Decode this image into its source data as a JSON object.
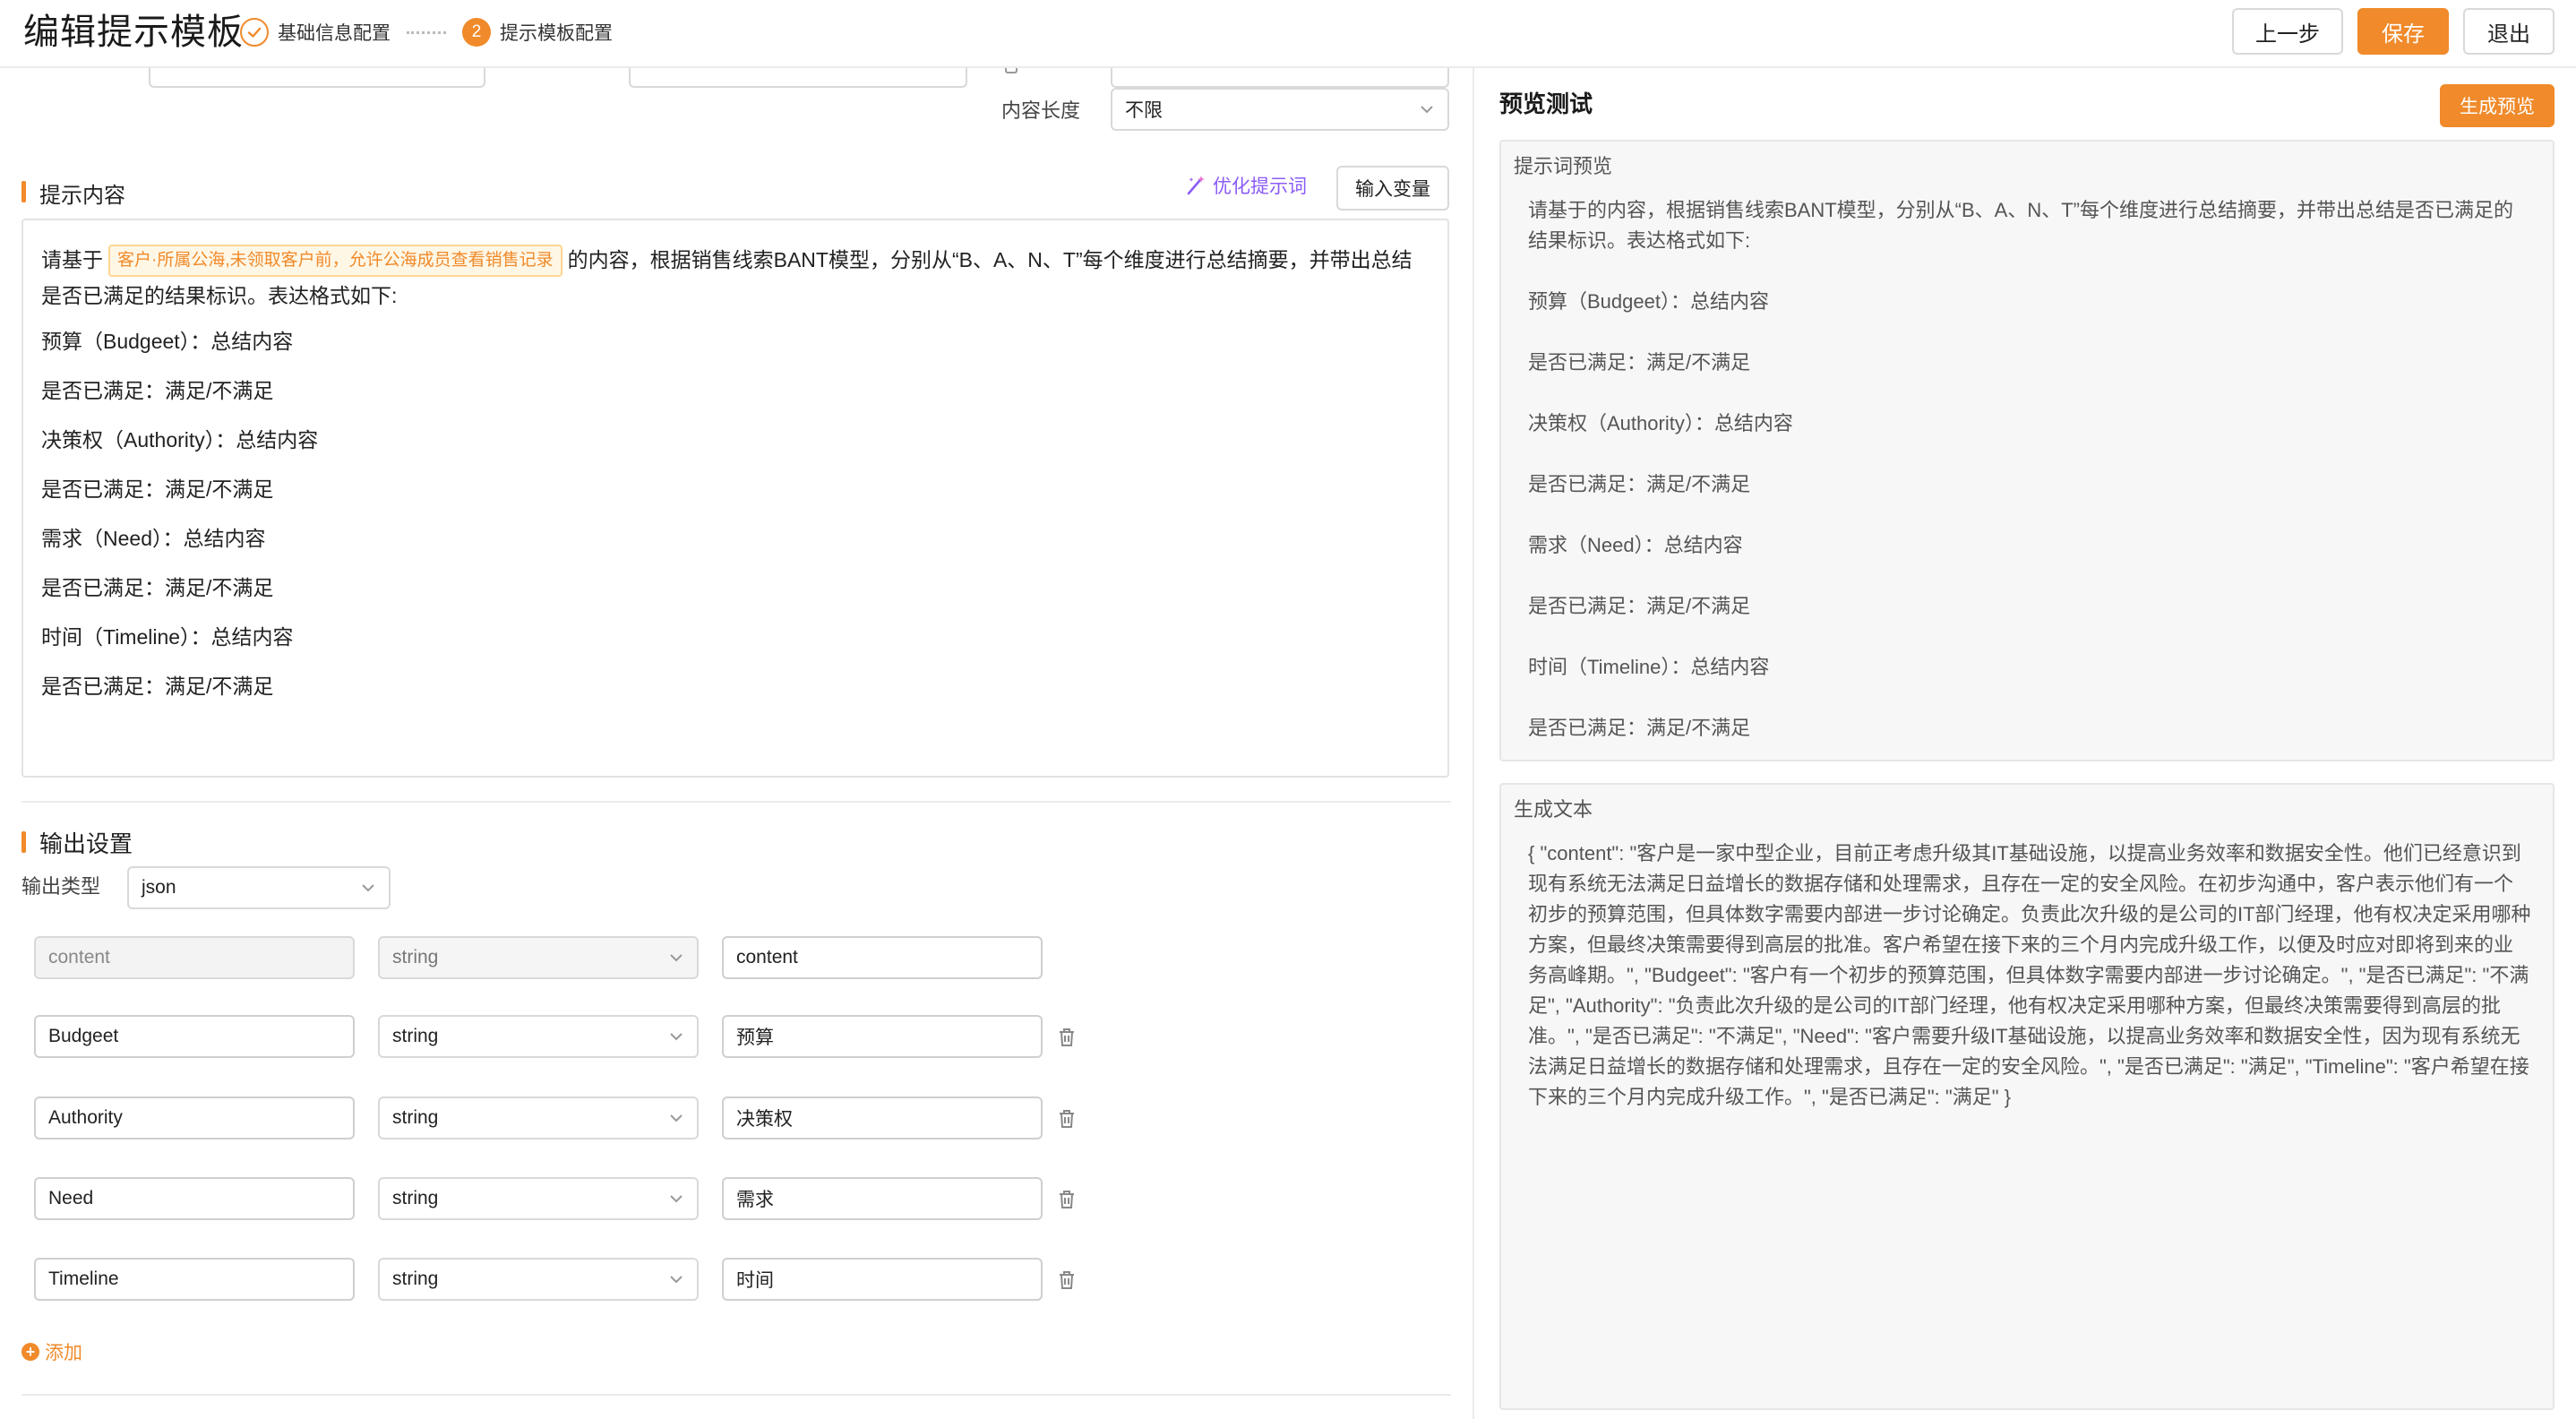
{
  "header": {
    "title": "编辑提示模板",
    "steps": [
      {
        "label": "基础信息配置"
      },
      {
        "number": "2",
        "label": "提示模板配置"
      }
    ],
    "buttons": {
      "prev": "上一步",
      "save": "保存",
      "exit": "退出"
    }
  },
  "form": {
    "content_length_label": "内容长度",
    "content_length_value": "不限"
  },
  "prompt": {
    "section_title": "提示内容",
    "optimize_label": "优化提示词",
    "insert_var_label": "输入变量",
    "intro_prefix": "请基于",
    "variable_tag": "客户·所属公海,未领取客户前，允许公海成员查看销售记录",
    "intro_suffix": "的内容，根据销售线索BANT模型，分别从“B、A、N、T”每个维度进行总结摘要，并带出总结是否已满足的结果标识。表达格式如下:",
    "lines": [
      "预算（Budgeet）：总结内容",
      "是否已满足：满足/不满足",
      "决策权（Authority）：总结内容",
      "是否已满足：满足/不满足",
      "需求（Need）：总结内容",
      "是否已满足：满足/不满足",
      "时间（Timeline）：总结内容",
      "是否已满足：满足/不满足"
    ]
  },
  "output": {
    "section_title": "输出设置",
    "type_label": "输出类型",
    "type_value": "json",
    "fields": [
      {
        "key": "content",
        "type": "string",
        "desc": "content"
      },
      {
        "key": "Budgeet",
        "type": "string",
        "desc": "预算"
      },
      {
        "key": "Authority",
        "type": "string",
        "desc": "决策权"
      },
      {
        "key": "Need",
        "type": "string",
        "desc": "需求"
      },
      {
        "key": "Timeline",
        "type": "string",
        "desc": "时间"
      }
    ],
    "add_label": "添加"
  },
  "preview": {
    "title": "预览测试",
    "generate_label": "生成预览",
    "prompt_preview_label": "提示词预览",
    "prompt_preview_lines": [
      "请基于的内容，根据销售线索BANT模型，分别从“B、A、N、T”每个维度进行总结摘要，并带出总结是否已满足的结果标识。表达格式如下:",
      "预算（Budgeet）：总结内容",
      "是否已满足：满足/不满足",
      "决策权（Authority）：总结内容",
      "是否已满足：满足/不满足",
      "需求（Need）：总结内容",
      "是否已满足：满足/不满足",
      "时间（Timeline）：总结内容",
      "是否已满足：满足/不满足"
    ],
    "generated_label": "生成文本",
    "generated_text": "{ \"content\": \"客户是一家中型企业，目前正考虑升级其IT基础设施，以提高业务效率和数据安全性。他们已经意识到现有系统无法满足日益增长的数据存储和处理需求，且存在一定的安全风险。在初步沟通中，客户表示他们有一个初步的预算范围，但具体数字需要内部进一步讨论确定。负责此次升级的是公司的IT部门经理，他有权决定采用哪种方案，但最终决策需要得到高层的批准。客户希望在接下来的三个月内完成升级工作，以便及时应对即将到来的业务高峰期。\", \"Budgeet\": \"客户有一个初步的预算范围，但具体数字需要内部进一步讨论确定。\", \"是否已满足\": \"不满足\", \"Authority\": \"负责此次升级的是公司的IT部门经理，他有权决定采用哪种方案，但最终决策需要得到高层的批准。\", \"是否已满足\": \"不满足\", \"Need\": \"客户需要升级IT基础设施，以提高业务效率和数据安全性，因为现有系统无法满足日益增长的数据存储和处理需求，且存在一定的安全风险。\", \"是否已满足\": \"满足\", \"Timeline\": \"客户希望在接下来的三个月内完成升级工作。\", \"是否已满足\": \"满足\" }"
  },
  "colors": {
    "accent": "#f08a2a",
    "optimize": "#8b5cf6"
  }
}
